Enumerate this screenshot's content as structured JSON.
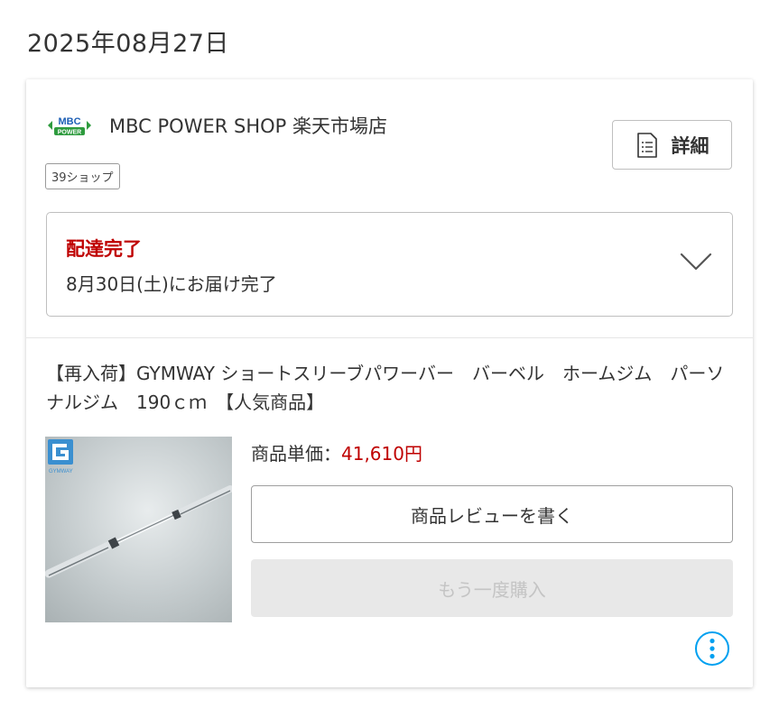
{
  "order_date": "2025年08月27日",
  "shop": {
    "logo_text_top": "MBC",
    "logo_text_bottom": "POWER",
    "name": "MBC POWER SHOP 楽天市場店",
    "badge": "39ショップ",
    "detail_label": "詳細"
  },
  "delivery": {
    "status": "配達完了",
    "detail": "8月30日(土)にお届け完了"
  },
  "product": {
    "title": "【再入荷】GYMWAY ショートスリーブパワーバー　バーベル　ホームジム　パーソナルジム　190ｃｍ　【人気商品】",
    "image_logo_text": "GYMWAY",
    "price_label": "商品単価：",
    "price_value": "41,610円",
    "review_button": "商品レビューを書く",
    "rebuy_button": "もう一度購入"
  },
  "colors": {
    "accent_red": "#bf0000",
    "info_blue": "#00a0f0",
    "logo_green": "#2e9b3e",
    "logo_blue": "#1d5fb5"
  },
  "icons": [
    "document-icon",
    "chevron-down-icon",
    "more-vertical-icon"
  ]
}
